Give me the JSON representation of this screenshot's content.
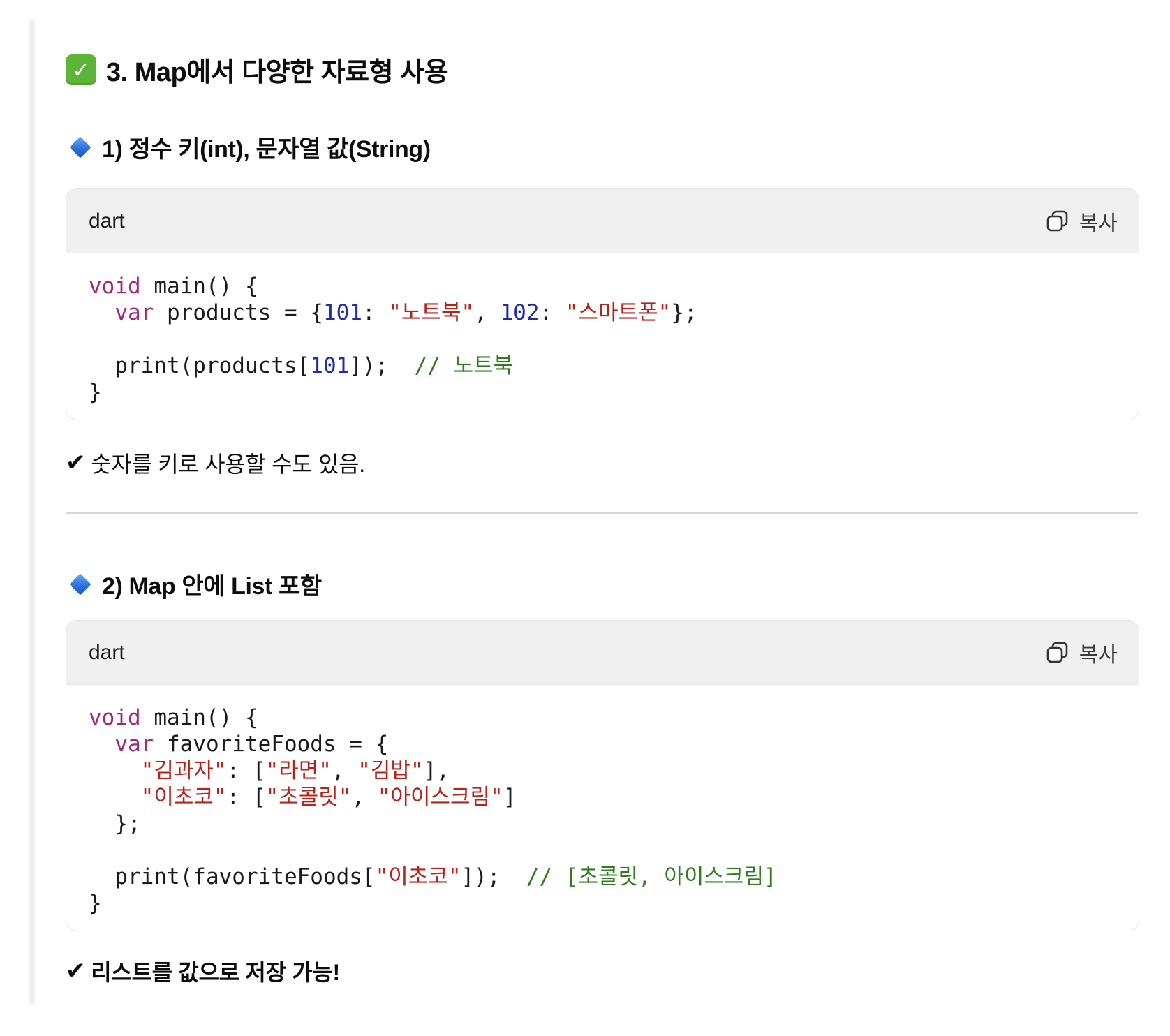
{
  "section": {
    "title": "3. Map에서 다양한 자료형 사용",
    "icon": "check-mark-button-icon"
  },
  "blocks": [
    {
      "heading": "1) 정수 키(int), 문자열 값(String)",
      "code_lang": "dart",
      "copy_label": "복사",
      "code_lines": [
        "void main() {",
        "  var products = {101: \"노트북\", 102: \"스마트폰\"};",
        "",
        "  print(products[101]);  // 노트북",
        "}"
      ],
      "note": "숫자를 키로 사용할 수도 있음."
    },
    {
      "heading": "2) Map 안에 List 포함",
      "code_lang": "dart",
      "copy_label": "복사",
      "code_lines": [
        "void main() {",
        "  var favoriteFoods = {",
        "    \"김과자\": [\"라면\", \"김밥\"],",
        "    \"이초코\": [\"초콜릿\", \"아이스크림\"]",
        "  };",
        "",
        "  print(favoriteFoods[\"이초코\"]);  // [초콜릿, 아이스크림]",
        "}"
      ],
      "note": "리스트를 값으로 저장 가능!"
    }
  ],
  "note_mark": "✔",
  "colors": {
    "keyword": "#a0267f",
    "string": "#b5231b",
    "number": "#1f2ea8",
    "comment": "#2f7d1d",
    "header_bg": "#f0f0f0"
  }
}
